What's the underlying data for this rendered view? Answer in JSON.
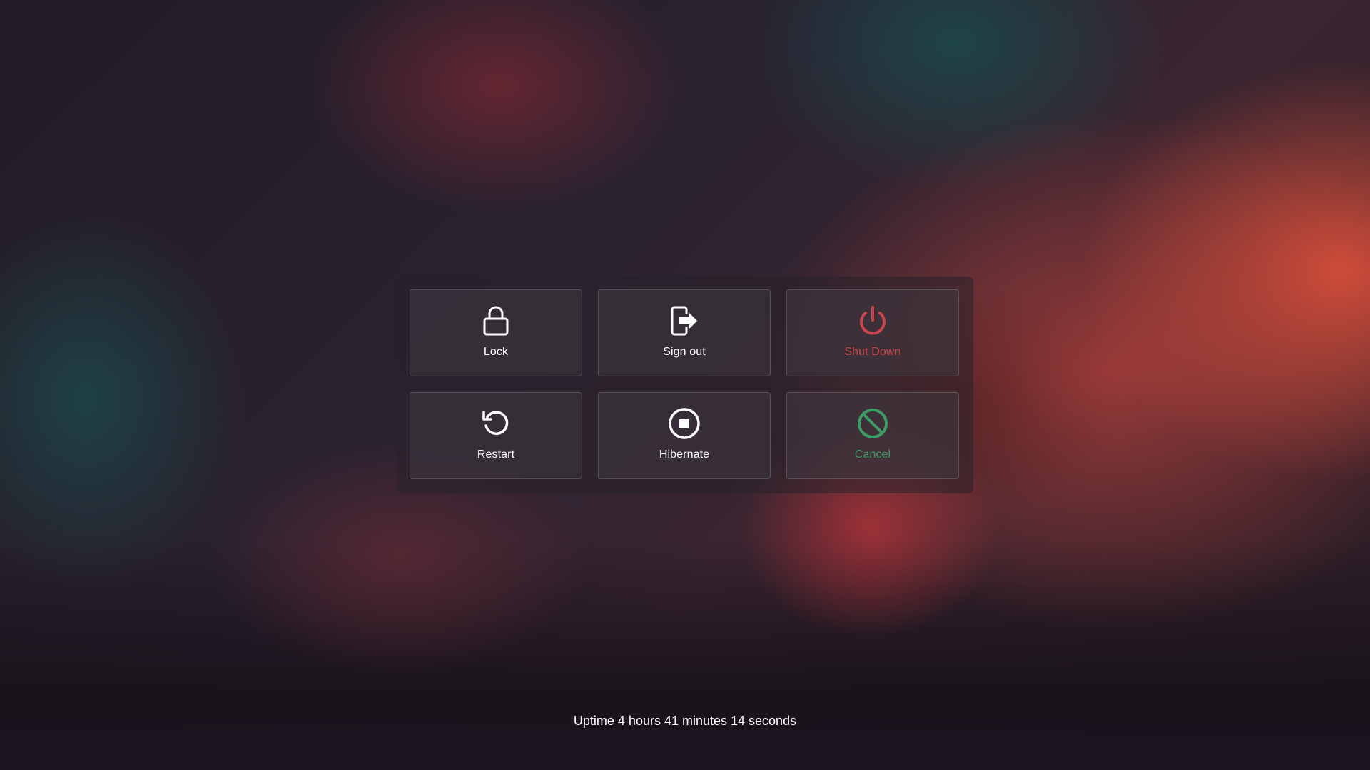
{
  "actions": {
    "lock": {
      "label": "Lock",
      "icon": "lock-icon"
    },
    "sign_out": {
      "label": "Sign out",
      "icon": "sign-out-icon"
    },
    "shut_down": {
      "label": "Shut Down",
      "icon": "power-icon",
      "color": "#c9464f"
    },
    "restart": {
      "label": "Restart",
      "icon": "restart-icon"
    },
    "hibernate": {
      "label": "Hibernate",
      "icon": "hibernate-icon"
    },
    "cancel": {
      "label": "Cancel",
      "icon": "cancel-icon",
      "color": "#3c9c65"
    }
  },
  "uptime": {
    "text": "Uptime 4 hours 41 minutes 14 seconds"
  }
}
